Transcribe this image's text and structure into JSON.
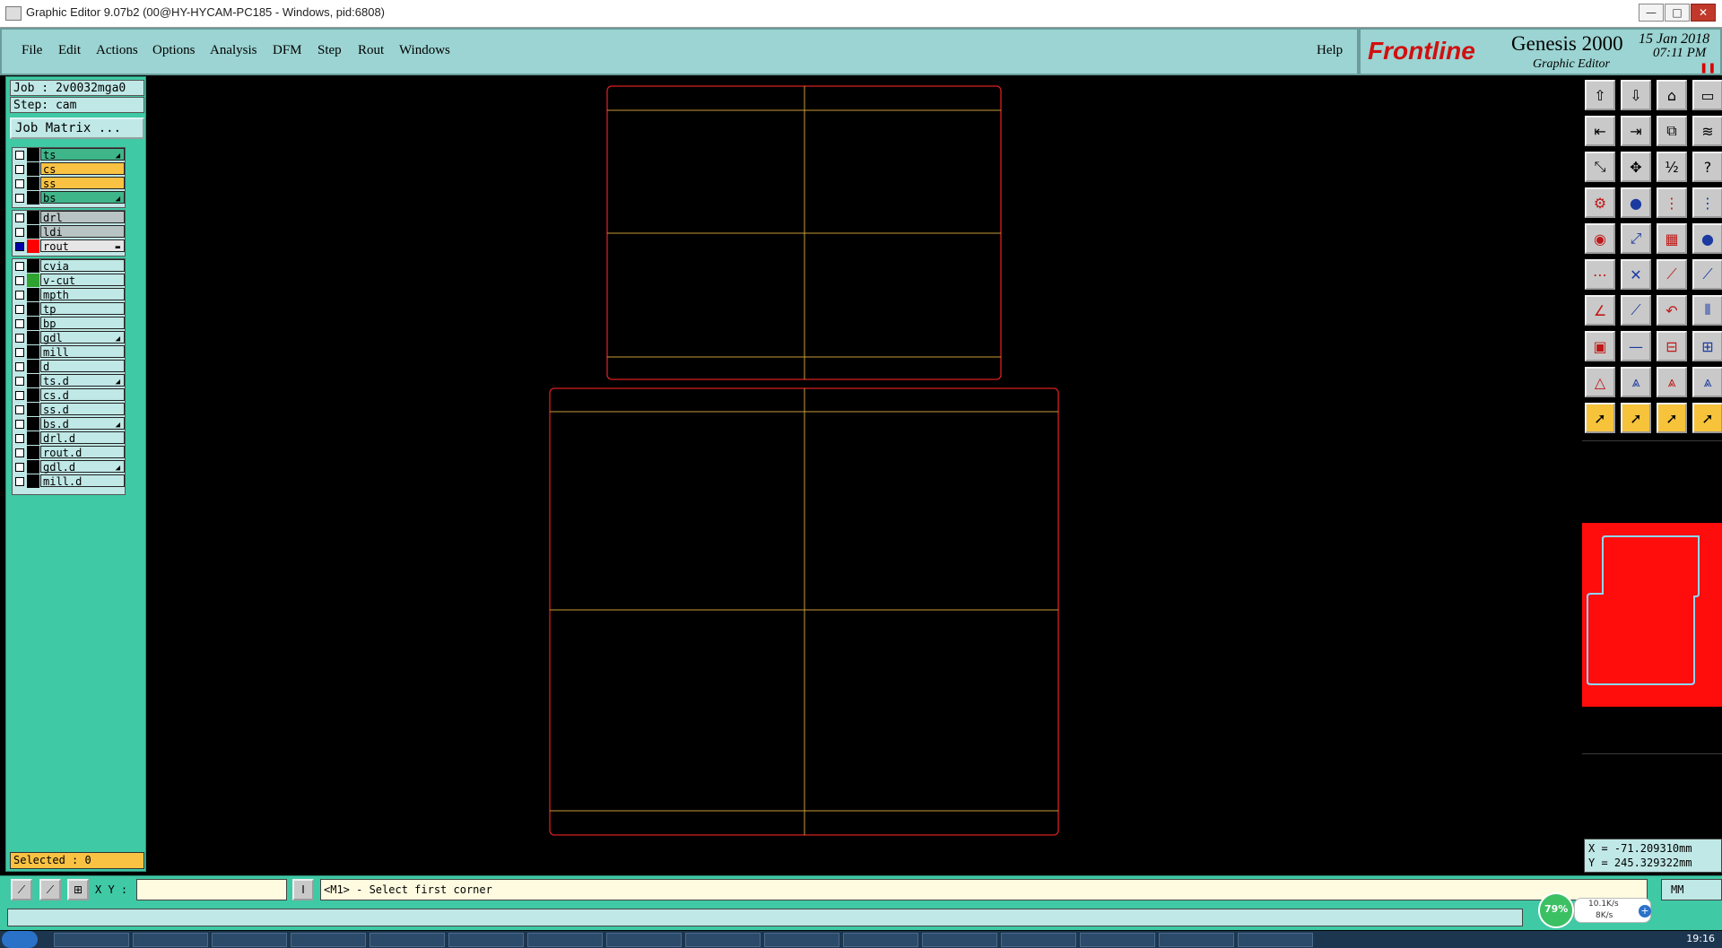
{
  "window": {
    "title": "Graphic Editor 9.07b2 (00@HY-HYCAM-PC185 - Windows, pid:6808)",
    "controls": [
      "—",
      "□",
      "✕"
    ]
  },
  "menu": {
    "items": [
      "File",
      "Edit",
      "Actions",
      "Options",
      "Analysis",
      "DFM",
      "Step",
      "Rout",
      "Windows"
    ],
    "help": "Help"
  },
  "brand": {
    "logo": "Frontline",
    "product": "Genesis 2000",
    "subtitle": "Graphic Editor",
    "date": "15 Jan 2018",
    "time": "07:11 PM"
  },
  "job": {
    "job_label": "Job : 2v0032mga0",
    "step_label": "Step: cam",
    "matrix_button": "Job Matrix ..."
  },
  "layers": {
    "group1": [
      {
        "name": "ts",
        "color": "#3fb58a",
        "swatch": "#000000",
        "marked": true
      },
      {
        "name": "cs",
        "color": "#f9c243",
        "swatch": "#000000",
        "marked": false
      },
      {
        "name": "ss",
        "color": "#f9c243",
        "swatch": "#000000",
        "marked": false
      },
      {
        "name": "bs",
        "color": "#3fb58a",
        "swatch": "#000000",
        "marked": true
      }
    ],
    "group2": [
      {
        "name": "drl",
        "color": "#b8c4c4",
        "swatch": "#000000",
        "marked": false
      },
      {
        "name": "ldi",
        "color": "#b8c4c4",
        "swatch": "#000000",
        "marked": false
      },
      {
        "name": "rout",
        "color": "#e6e6e6",
        "swatch": "#ff0000",
        "marked": true,
        "active": true
      }
    ],
    "group3": [
      {
        "name": "cvia",
        "color": "#bfe8e6",
        "swatch": "#000000",
        "marked": false
      },
      {
        "name": "v-cut",
        "color": "#bfe8e6",
        "swatch": "#2fa32f",
        "marked": false
      },
      {
        "name": "mpth",
        "color": "#bfe8e6",
        "swatch": "#000000",
        "marked": false
      },
      {
        "name": "tp",
        "color": "#bfe8e6",
        "swatch": "#000000",
        "marked": false
      },
      {
        "name": "bp",
        "color": "#bfe8e6",
        "swatch": "#000000",
        "marked": false
      },
      {
        "name": "gdl",
        "color": "#bfe8e6",
        "swatch": "#000000",
        "marked": true
      },
      {
        "name": "mill",
        "color": "#bfe8e6",
        "swatch": "#000000",
        "marked": false
      },
      {
        "name": "d",
        "color": "#bfe8e6",
        "swatch": "#000000",
        "marked": false
      },
      {
        "name": "ts.d",
        "color": "#bfe8e6",
        "swatch": "#000000",
        "marked": true
      },
      {
        "name": "cs.d",
        "color": "#bfe8e6",
        "swatch": "#000000",
        "marked": false
      },
      {
        "name": "ss.d",
        "color": "#bfe8e6",
        "swatch": "#000000",
        "marked": false
      },
      {
        "name": "bs.d",
        "color": "#bfe8e6",
        "swatch": "#000000",
        "marked": true
      },
      {
        "name": "drl.d",
        "color": "#bfe8e6",
        "swatch": "#000000",
        "marked": false
      },
      {
        "name": "rout.d",
        "color": "#bfe8e6",
        "swatch": "#000000",
        "marked": false
      },
      {
        "name": "gdl.d",
        "color": "#bfe8e6",
        "swatch": "#000000",
        "marked": true
      },
      {
        "name": "mill.d",
        "color": "#bfe8e6",
        "swatch": "#000000",
        "marked": false
      }
    ]
  },
  "status": {
    "selected": "Selected : 0",
    "xy_label": "X Y :",
    "xy_value": "",
    "message": "<M1> - Select first corner",
    "units": "MM",
    "coord_x": "X = -71.209310mm",
    "coord_y": "Y = 245.329322mm"
  },
  "toolbar_icons": [
    [
      "open-icon",
      "save-icon",
      "home-icon",
      "window-icon"
    ],
    [
      "undo-icon",
      "redo-icon",
      "copy-window-icon",
      "snap-icon"
    ],
    [
      "zoom-fit-icon",
      "zoom-center-icon",
      "scale-one-to-two-icon",
      "help-icon"
    ],
    [
      "measure-icon",
      "record-icon",
      "pads-icon",
      "nets-icon"
    ],
    [
      "select-pad-icon",
      "transform-icon",
      "ruler-icon",
      "circle-icon"
    ],
    [
      "connect-icon",
      "cross-icon",
      "line-point-icon",
      "line-end-icon"
    ],
    [
      "angle-line-icon",
      "slash-line-icon",
      "arc-icon",
      "bus-icon"
    ],
    [
      "pad-drag-icon",
      "dash-icon",
      "frame-icon",
      "group-icon"
    ],
    [
      "triangle-icon",
      "up-arrow-icon",
      "up-arrow-alt-icon",
      "up-arrow-end-icon"
    ],
    [
      "pointer-icon",
      "pointer-alt-icon",
      "pointer-sel-icon",
      "pointer-multi-icon"
    ]
  ],
  "colors": {
    "panel_bg": "#3fc9a5",
    "menubar_bg": "#9bd4d2",
    "outline": "#d62020",
    "gridline": "#c99a3a",
    "preview_fill": "#ff0d0d",
    "preview_outline": "#8fd6ff"
  },
  "system": {
    "net_percent": "79%",
    "up_rate": "10.1K/s",
    "down_rate": "8K/s",
    "clock": "19:16"
  }
}
